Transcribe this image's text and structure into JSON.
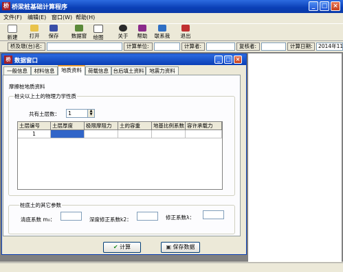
{
  "app": {
    "title": "桥梁桩基础计算程序",
    "icon": "bridge-app-icon"
  },
  "window_controls": {
    "minimize": "_",
    "maximize": "□",
    "close": "×"
  },
  "menu": [
    {
      "label": "文件(F)"
    },
    {
      "label": "编辑(E)"
    },
    {
      "label": "窗口(W)"
    },
    {
      "label": "帮助(H)"
    }
  ],
  "toolbar": [
    {
      "label": "新建",
      "icon": "new-file-icon"
    },
    {
      "label": "打开",
      "icon": "open-folder-icon"
    },
    {
      "label": "保存",
      "icon": "save-icon"
    },
    {
      "label": "数据窗",
      "icon": "data-window-icon"
    },
    {
      "label": "绘图",
      "icon": "plot-icon"
    },
    {
      "label": "关于",
      "icon": "about-icon"
    },
    {
      "label": "帮助",
      "icon": "help-book-icon"
    },
    {
      "label": "联系我",
      "icon": "contact-icon"
    },
    {
      "label": "退出",
      "icon": "exit-icon"
    }
  ],
  "infobar": {
    "bridge_label": "桥及墩(台)名:",
    "unit_label": "计算单位:",
    "calculator_label": "计算者:",
    "reviewer_label": "复核者:",
    "date_label": "计算日期:",
    "date_value": "2014年11"
  },
  "child_window": {
    "title": "数据窗口"
  },
  "tabs": [
    {
      "label": "一般信息"
    },
    {
      "label": "材料信息"
    },
    {
      "label": "地质资料"
    },
    {
      "label": "荷载信息"
    },
    {
      "label": "台后填土资料"
    },
    {
      "label": "地震力资料"
    }
  ],
  "panel": {
    "section_title": "摩擦桩地质资料",
    "group1_label": "桩尖以上土的物理力学性质",
    "layer_count_label": "共有土层数：",
    "layer_count_value": "1",
    "table": {
      "headers": [
        "土层编号",
        "土层厚度",
        "极限摩阻力",
        "土的容重",
        "地基比例系数",
        "容许承载力"
      ],
      "rows": [
        [
          "1",
          "",
          "",
          "",
          "",
          ""
        ]
      ]
    },
    "group2_label": "桩底土的其它参数",
    "m0_label": "清底系数 m₀：",
    "k2_label": "深度修正系数k2：",
    "lambda_label": "修正系数λ：",
    "calc_button": "计算",
    "save_button": "保存数据"
  }
}
